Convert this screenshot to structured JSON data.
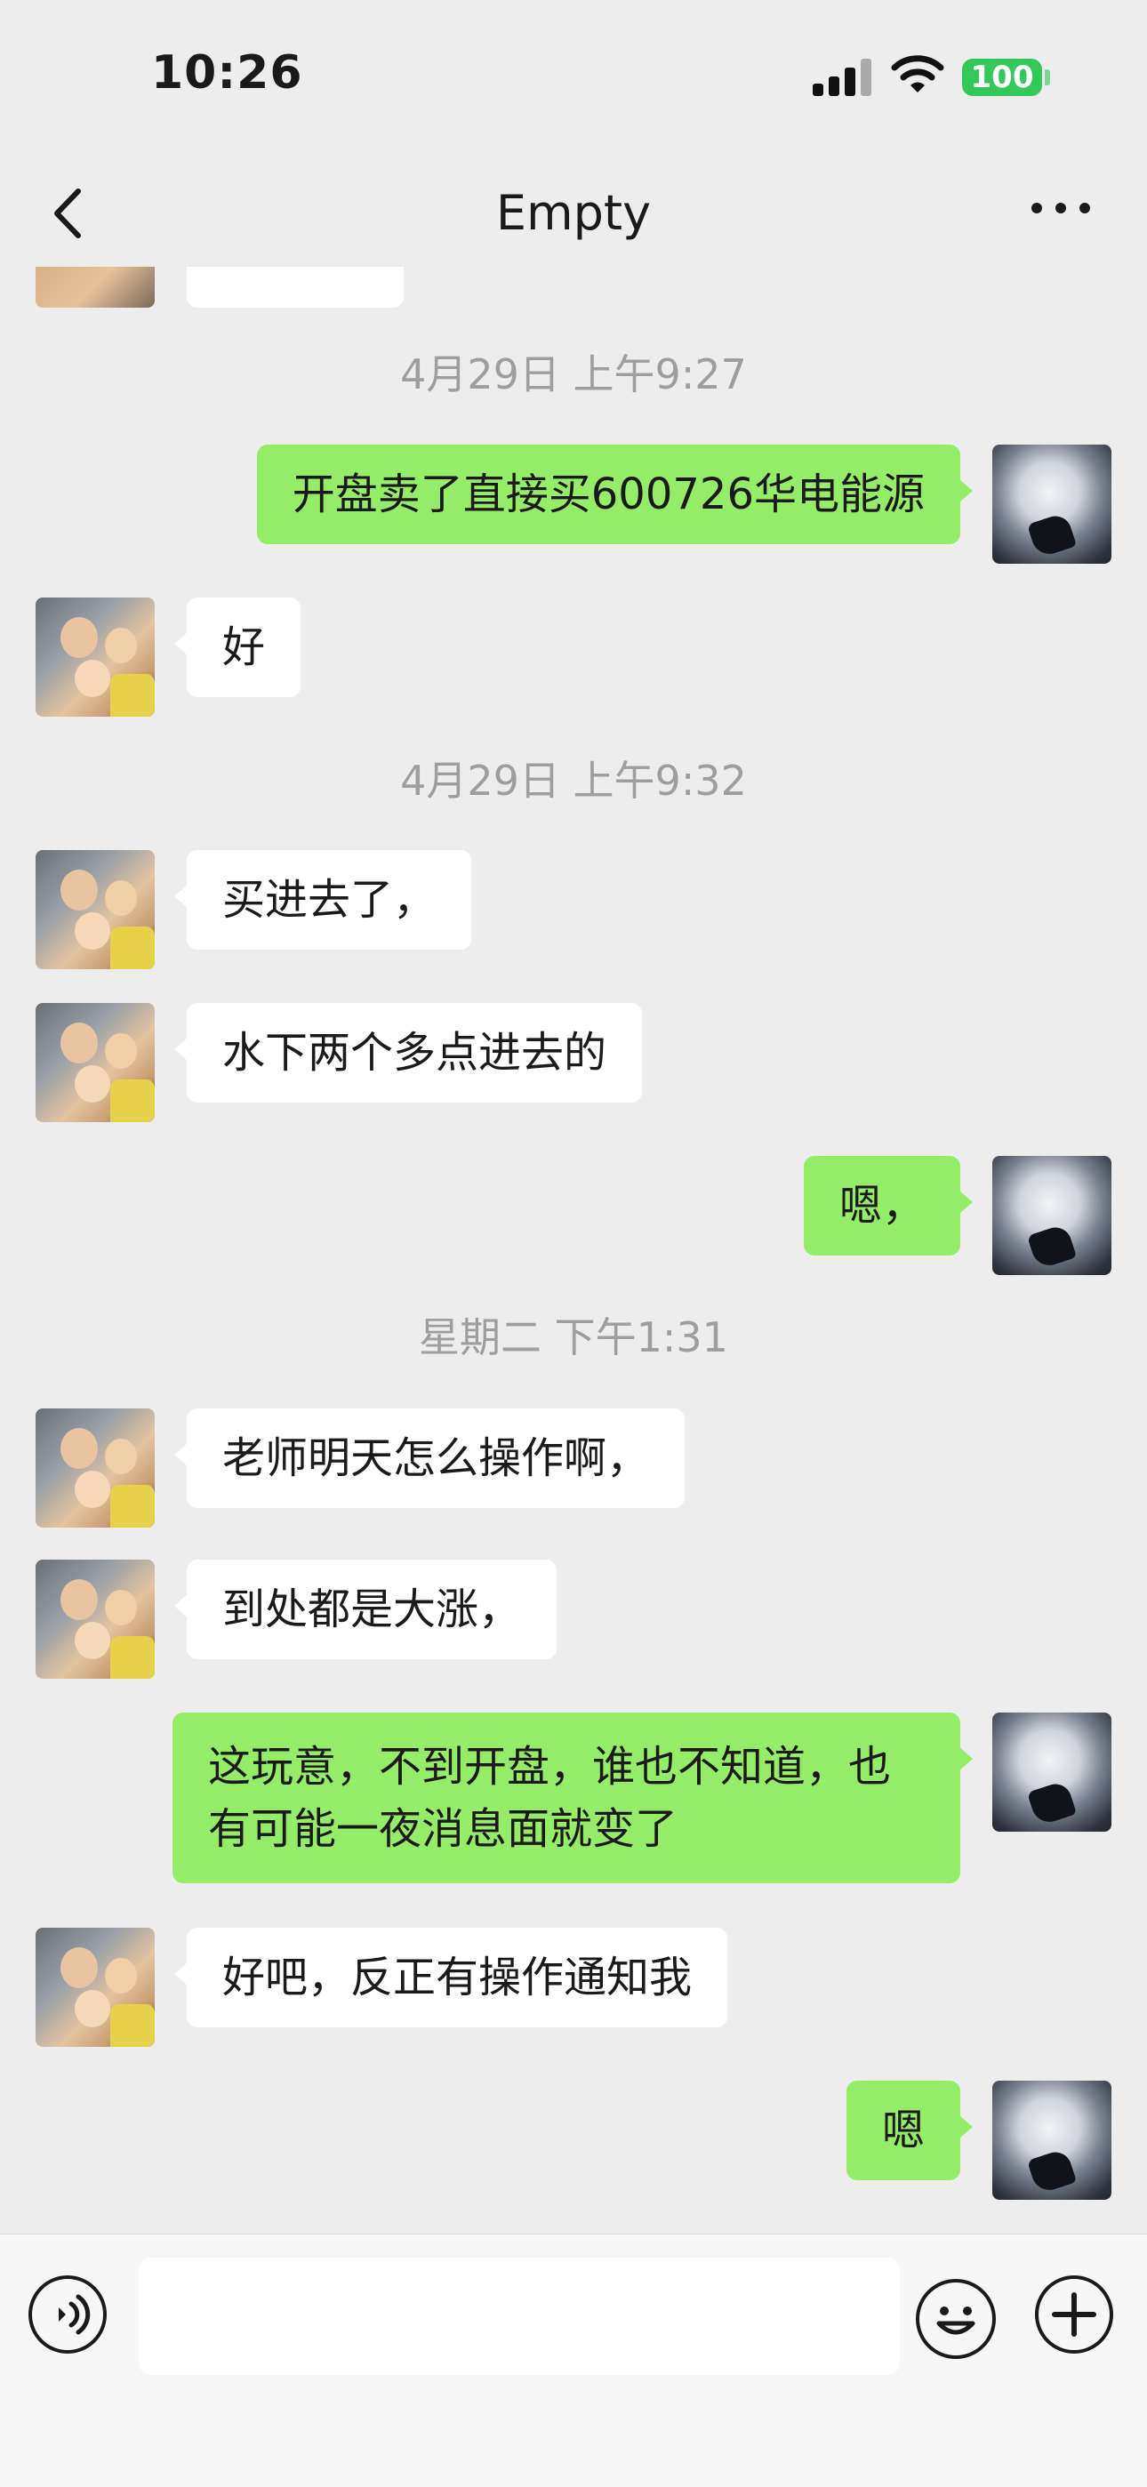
{
  "status_bar": {
    "time": "10:26",
    "battery": "100",
    "icons": [
      "cellular-signal-icon",
      "wifi-icon",
      "battery-icon"
    ]
  },
  "nav": {
    "title": "Empty",
    "back_icon": "chevron-left-icon",
    "more_icon": "more-dots-icon"
  },
  "colors": {
    "background": "#EDEDED",
    "sent_bubble": "#95EC69",
    "received_bubble": "#FFFFFF",
    "battery": "#34C759",
    "timestamp": "#9E9E9E"
  },
  "timestamps": [
    "4月29日 上午9:27",
    "4月29日 上午9:32",
    "星期二 下午1:31"
  ],
  "messages": [
    {
      "side": "right",
      "text": "开盘卖了直接买600726华电能源"
    },
    {
      "side": "left",
      "text": "好"
    },
    {
      "side": "left",
      "text": "买进去了，"
    },
    {
      "side": "left",
      "text": "水下两个多点进去的"
    },
    {
      "side": "right",
      "text": "嗯，"
    },
    {
      "side": "left",
      "text": "老师明天怎么操作啊，"
    },
    {
      "side": "left",
      "text": "到处都是大涨，"
    },
    {
      "side": "right",
      "text": "这玩意，不到开盘，谁也不知道，也有可能一夜消息面就变了"
    },
    {
      "side": "left",
      "text": "好吧，反正有操作通知我"
    },
    {
      "side": "right",
      "text": "嗯"
    }
  ],
  "input_bar": {
    "placeholder": "",
    "voice_icon": "voice-icon",
    "emoji_icon": "emoji-icon",
    "plus_icon": "plus-icon"
  }
}
